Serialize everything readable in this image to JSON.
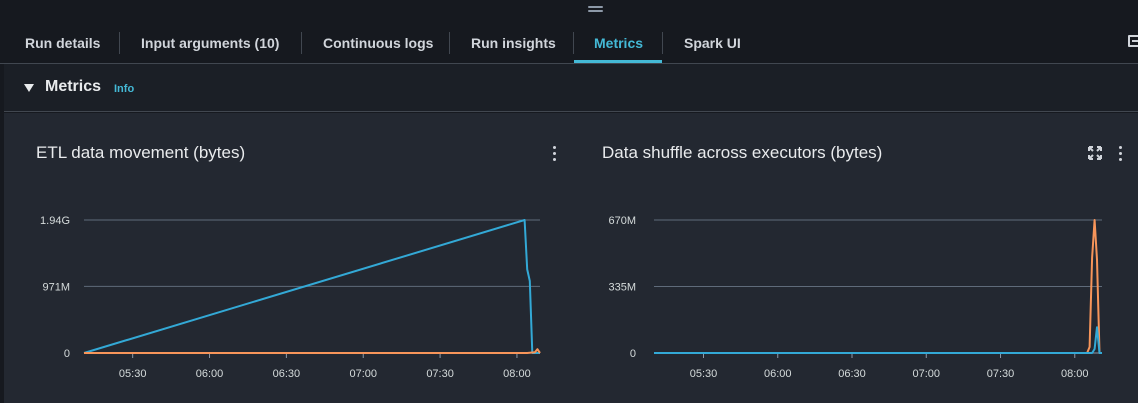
{
  "tabs": [
    {
      "label": "Run details",
      "active": false
    },
    {
      "label": "Input arguments (10)",
      "active": false
    },
    {
      "label": "Continuous logs",
      "active": false
    },
    {
      "label": "Run insights",
      "active": false
    },
    {
      "label": "Metrics",
      "active": true
    },
    {
      "label": "Spark UI",
      "active": false
    }
  ],
  "section": {
    "title": "Metrics",
    "info": "Info"
  },
  "charts": [
    {
      "title": "ETL data movement (bytes)"
    },
    {
      "title": "Data shuffle across executors (bytes)"
    }
  ],
  "colors": {
    "accent": "#44b9d6",
    "series_blue": "#33a9d6",
    "series_orange": "#f7955a"
  },
  "chart_data": [
    {
      "type": "line",
      "title": "ETL data movement (bytes)",
      "y_tick_labels": [
        "0",
        "971M",
        "1.94G"
      ],
      "y_tick_values": [
        0,
        971000000,
        1940000000
      ],
      "ylim": [
        0,
        1940000000
      ],
      "x_tick_labels": [
        "05:30",
        "06:00",
        "06:30",
        "07:00",
        "07:30",
        "08:00"
      ],
      "x_tick_values": [
        "05:30",
        "06:00",
        "06:30",
        "07:00",
        "07:30",
        "08:00"
      ],
      "xlim": [
        "05:11",
        "08:09"
      ],
      "grid": true,
      "series": [
        {
          "color": "#33a9d6",
          "x": [
            "05:11",
            "08:03",
            "08:04",
            "08:05",
            "08:06",
            "08:07",
            "08:08",
            "08:09"
          ],
          "y": [
            0,
            1940000000,
            1220000000,
            1050000000,
            0,
            0,
            0,
            0
          ]
        },
        {
          "color": "#f7955a",
          "x": [
            "05:11",
            "08:04",
            "08:07",
            "08:08",
            "08:09"
          ],
          "y": [
            0,
            0,
            10000000,
            55000000,
            0
          ]
        }
      ]
    },
    {
      "type": "line",
      "title": "Data shuffle across executors (bytes)",
      "y_tick_labels": [
        "0",
        "335M",
        "670M"
      ],
      "y_tick_values": [
        0,
        335000000,
        670000000
      ],
      "ylim": [
        0,
        670000000
      ],
      "x_tick_labels": [
        "05:30",
        "06:00",
        "06:30",
        "07:00",
        "07:30",
        "08:00"
      ],
      "x_tick_values": [
        "05:30",
        "06:00",
        "06:30",
        "07:00",
        "07:30",
        "08:00"
      ],
      "xlim": [
        "05:10",
        "08:11"
      ],
      "grid": true,
      "series": [
        {
          "color": "#f7955a",
          "x": [
            "05:10",
            "08:05",
            "08:06",
            "08:07",
            "08:08",
            "08:09",
            "08:10",
            "08:11"
          ],
          "y": [
            0,
            0,
            30000000,
            480000000,
            670000000,
            470000000,
            0,
            0
          ]
        },
        {
          "color": "#33a9d6",
          "x": [
            "05:10",
            "08:07",
            "08:08",
            "08:09",
            "08:10",
            "08:11"
          ],
          "y": [
            0,
            0,
            20000000,
            130000000,
            0,
            0
          ]
        }
      ]
    }
  ]
}
